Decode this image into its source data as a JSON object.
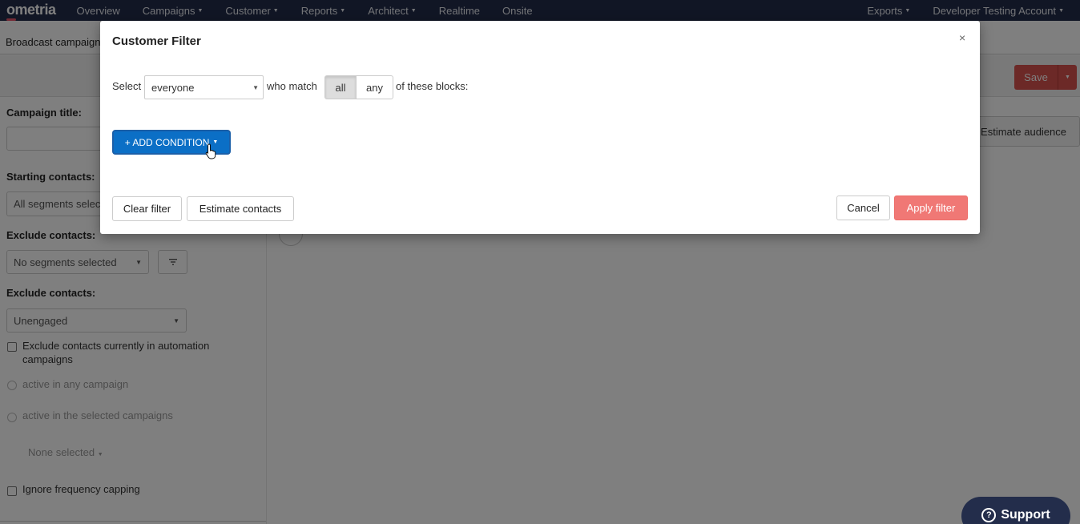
{
  "nav": {
    "logo": "ometria",
    "items": [
      "Overview",
      "Campaigns",
      "Customer",
      "Reports",
      "Architect",
      "Realtime",
      "Onsite"
    ],
    "right_items": [
      "Exports",
      "Developer Testing Account"
    ]
  },
  "page": {
    "breadcrumb": "Broadcast campaign",
    "save_label": "Save",
    "estimate_audience_label": "Estimate audience",
    "campaign_title_label": "Campaign title:",
    "starting_contacts_label": "Starting contacts:",
    "starting_contacts_value": "All segments selected",
    "exclude_contacts_label_1": "Exclude contacts:",
    "exclude_segments_value": "No segments selected",
    "exclude_contacts_label_2": "Exclude contacts:",
    "exclude_engagement_value": "Unengaged",
    "exclude_automation_label": "Exclude contacts currently in automation campaigns",
    "radio_any_label": "active in any campaign",
    "radio_selected_label": "active in the selected campaigns",
    "campaigns_select_value": "None selected",
    "ignore_frequency_label": "Ignore frequency capping"
  },
  "modal": {
    "title": "Customer Filter",
    "close_glyph": "×",
    "select_prefix": "Select",
    "select_value": "everyone",
    "who_match": "who match",
    "match_all": "all",
    "match_any": "any",
    "of_these_blocks": "of these blocks:",
    "add_condition_label": "+ ADD CONDITION",
    "clear_filter_label": "Clear filter",
    "estimate_contacts_label": "Estimate contacts",
    "cancel_label": "Cancel",
    "apply_filter_label": "Apply filter"
  },
  "support": {
    "label": "Support",
    "icon_glyph": "?"
  },
  "colors": {
    "nav_bg": "#232d4b",
    "primary_blue": "#0b6fc6",
    "apply_red": "#f07875",
    "save_red": "#d9534f"
  }
}
